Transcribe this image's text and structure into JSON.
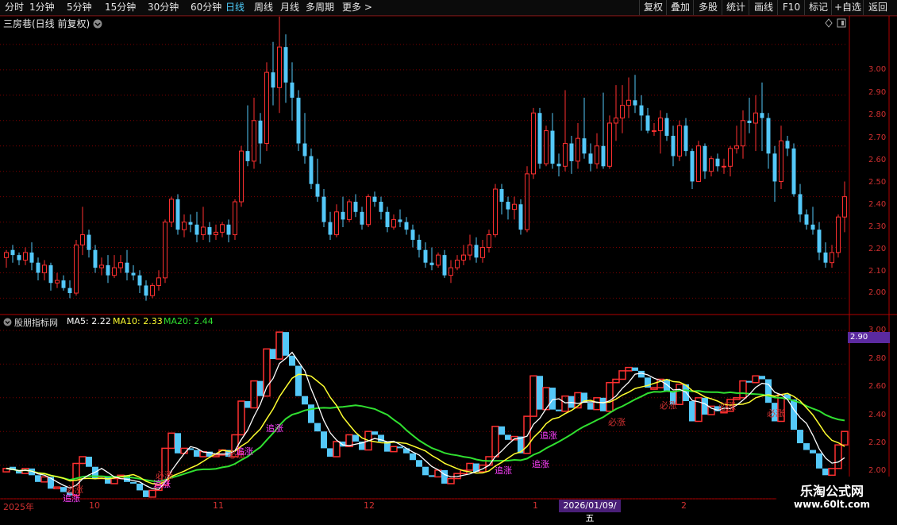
{
  "toolbar": {
    "timeframes": [
      "分时",
      "1分钟",
      "5分钟",
      "15分钟",
      "30分钟",
      "60分钟",
      "日线",
      "周线",
      "月线",
      "多周期",
      "更多"
    ],
    "active_timeframe": "日线",
    "more_arrow": ">",
    "buttons": [
      "复权",
      "叠加",
      "多股",
      "统计",
      "画线",
      "F10",
      "标记",
      "+自选",
      "返回"
    ]
  },
  "main_chart": {
    "title": "三房巷(日线 前复权)",
    "price_labels": [
      "3.00",
      "2.90",
      "2.80",
      "2.70",
      "2.60",
      "2.50",
      "2.40",
      "2.30",
      "2.20",
      "2.10",
      "2.00"
    ]
  },
  "sub_chart": {
    "name": "股朋指标网",
    "ma5": "MA5: 2.22",
    "ma10": "MA10: 2.33",
    "ma20": "MA20: 2.44",
    "price_labels": [
      "3.00",
      "2.80",
      "2.60",
      "2.40",
      "2.20",
      "2.00"
    ],
    "highlight_price": "2.90",
    "annotations": [
      "必涨",
      "追涨"
    ]
  },
  "date_axis": {
    "labels": [
      "2025年",
      "10",
      "11",
      "12",
      "1",
      "2"
    ],
    "highlight": "2026/01/09/五"
  },
  "watermark": {
    "line1": "乐淘公式网",
    "line2": "www.60lt.com"
  },
  "colors": {
    "up": "#ff3030",
    "down": "#54c8f8",
    "ma5": "#ffffff",
    "ma10": "#ffff30",
    "ma20": "#30e030",
    "grid": "#7a0000",
    "active": "#4fd0ff"
  },
  "chart_data": [
    {
      "type": "candlestick",
      "title": "三房巷(日线 前复权)",
      "ylim": [
        1.97,
        3.05
      ],
      "ohlc": [
        [
          2.16,
          2.18,
          2.12,
          2.19
        ],
        [
          2.19,
          2.17,
          2.14,
          2.21
        ],
        [
          2.17,
          2.15,
          2.13,
          2.18
        ],
        [
          2.15,
          2.18,
          2.13,
          2.2
        ],
        [
          2.18,
          2.14,
          2.11,
          2.22
        ],
        [
          2.14,
          2.1,
          2.07,
          2.16
        ],
        [
          2.1,
          2.13,
          2.07,
          2.15
        ],
        [
          2.13,
          2.06,
          2.03,
          2.14
        ],
        [
          2.06,
          2.07,
          2.04,
          2.1
        ],
        [
          2.07,
          2.04,
          2.03,
          2.09
        ],
        [
          2.04,
          2.02,
          2.0,
          2.07
        ],
        [
          2.02,
          2.21,
          2.01,
          2.23
        ],
        [
          2.21,
          2.25,
          2.17,
          2.36
        ],
        [
          2.25,
          2.19,
          2.16,
          2.27
        ],
        [
          2.19,
          2.12,
          2.1,
          2.21
        ],
        [
          2.12,
          2.13,
          2.09,
          2.16
        ],
        [
          2.13,
          2.09,
          2.06,
          2.17
        ],
        [
          2.09,
          2.12,
          2.08,
          2.17
        ],
        [
          2.12,
          2.14,
          2.1,
          2.17
        ],
        [
          2.14,
          2.1,
          2.07,
          2.19
        ],
        [
          2.1,
          2.09,
          2.07,
          2.13
        ],
        [
          2.09,
          2.05,
          2.02,
          2.11
        ],
        [
          2.05,
          2.01,
          1.99,
          2.07
        ],
        [
          2.01,
          2.05,
          2.0,
          2.06
        ],
        [
          2.05,
          2.08,
          2.03,
          2.11
        ],
        [
          2.08,
          2.3,
          2.06,
          2.31
        ],
        [
          2.3,
          2.39,
          2.28,
          2.4
        ],
        [
          2.39,
          2.27,
          2.25,
          2.41
        ],
        [
          2.27,
          2.3,
          2.24,
          2.33
        ],
        [
          2.3,
          2.29,
          2.26,
          2.33
        ],
        [
          2.29,
          2.25,
          2.22,
          2.34
        ],
        [
          2.25,
          2.28,
          2.23,
          2.36
        ],
        [
          2.28,
          2.25,
          2.22,
          2.3
        ],
        [
          2.25,
          2.26,
          2.23,
          2.29
        ],
        [
          2.26,
          2.29,
          2.24,
          2.3
        ],
        [
          2.29,
          2.25,
          2.22,
          2.31
        ],
        [
          2.25,
          2.38,
          2.23,
          2.39
        ],
        [
          2.38,
          2.58,
          2.36,
          2.6
        ],
        [
          2.58,
          2.54,
          2.52,
          2.76
        ],
        [
          2.54,
          2.7,
          2.51,
          2.79
        ],
        [
          2.7,
          2.61,
          2.53,
          2.73
        ],
        [
          2.61,
          2.89,
          2.58,
          2.93
        ],
        [
          2.89,
          2.83,
          2.76,
          3.01
        ],
        [
          2.83,
          2.99,
          2.73,
          3.11
        ],
        [
          2.99,
          2.85,
          2.77,
          3.04
        ],
        [
          2.85,
          2.79,
          2.7,
          2.93
        ],
        [
          2.79,
          2.61,
          2.58,
          2.82
        ],
        [
          2.61,
          2.56,
          2.53,
          2.73
        ],
        [
          2.56,
          2.45,
          2.43,
          2.59
        ],
        [
          2.45,
          2.4,
          2.38,
          2.55
        ],
        [
          2.4,
          2.3,
          2.28,
          2.43
        ],
        [
          2.3,
          2.25,
          2.23,
          2.34
        ],
        [
          2.25,
          2.34,
          2.24,
          2.37
        ],
        [
          2.34,
          2.31,
          2.28,
          2.4
        ],
        [
          2.31,
          2.38,
          2.3,
          2.39
        ],
        [
          2.38,
          2.34,
          2.32,
          2.41
        ],
        [
          2.34,
          2.29,
          2.27,
          2.36
        ],
        [
          2.29,
          2.4,
          2.28,
          2.41
        ],
        [
          2.4,
          2.38,
          2.36,
          2.42
        ],
        [
          2.38,
          2.34,
          2.31,
          2.4
        ],
        [
          2.34,
          2.28,
          2.26,
          2.36
        ],
        [
          2.28,
          2.31,
          2.27,
          2.33
        ],
        [
          2.31,
          2.3,
          2.28,
          2.35
        ],
        [
          2.3,
          2.27,
          2.25,
          2.32
        ],
        [
          2.27,
          2.23,
          2.2,
          2.29
        ],
        [
          2.23,
          2.19,
          2.16,
          2.25
        ],
        [
          2.19,
          2.14,
          2.12,
          2.22
        ],
        [
          2.14,
          2.13,
          2.11,
          2.2
        ],
        [
          2.13,
          2.17,
          2.12,
          2.18
        ],
        [
          2.17,
          2.09,
          2.08,
          2.19
        ],
        [
          2.09,
          2.12,
          2.06,
          2.15
        ],
        [
          2.12,
          2.15,
          2.11,
          2.17
        ],
        [
          2.15,
          2.17,
          2.13,
          2.21
        ],
        [
          2.17,
          2.21,
          2.15,
          2.25
        ],
        [
          2.21,
          2.16,
          2.14,
          2.24
        ],
        [
          2.16,
          2.2,
          2.14,
          2.23
        ],
        [
          2.2,
          2.25,
          2.18,
          2.27
        ],
        [
          2.25,
          2.43,
          2.24,
          2.45
        ],
        [
          2.43,
          2.38,
          2.33,
          2.45
        ],
        [
          2.38,
          2.35,
          2.31,
          2.4
        ],
        [
          2.35,
          2.37,
          2.31,
          2.4
        ],
        [
          2.37,
          2.27,
          2.25,
          2.39
        ],
        [
          2.27,
          2.49,
          2.26,
          2.52
        ],
        [
          2.49,
          2.73,
          2.47,
          2.75
        ],
        [
          2.73,
          2.53,
          2.51,
          2.75
        ],
        [
          2.53,
          2.66,
          2.52,
          2.68
        ],
        [
          2.66,
          2.53,
          2.51,
          2.73
        ],
        [
          2.53,
          2.52,
          2.48,
          2.57
        ],
        [
          2.52,
          2.61,
          2.5,
          2.82
        ],
        [
          2.61,
          2.54,
          2.49,
          2.64
        ],
        [
          2.54,
          2.63,
          2.51,
          2.69
        ],
        [
          2.63,
          2.57,
          2.55,
          2.79
        ],
        [
          2.57,
          2.53,
          2.5,
          2.61
        ],
        [
          2.53,
          2.6,
          2.51,
          2.65
        ],
        [
          2.6,
          2.52,
          2.51,
          2.81
        ],
        [
          2.52,
          2.69,
          2.51,
          2.72
        ],
        [
          2.69,
          2.71,
          2.62,
          2.84
        ],
        [
          2.71,
          2.76,
          2.65,
          2.84
        ],
        [
          2.76,
          2.78,
          2.71,
          2.87
        ],
        [
          2.78,
          2.76,
          2.73,
          2.88
        ],
        [
          2.76,
          2.72,
          2.66,
          2.8
        ],
        [
          2.72,
          2.66,
          2.65,
          2.75
        ],
        [
          2.66,
          2.66,
          2.64,
          2.69
        ],
        [
          2.66,
          2.71,
          2.57,
          2.74
        ],
        [
          2.71,
          2.64,
          2.62,
          2.73
        ],
        [
          2.64,
          2.56,
          2.52,
          2.68
        ],
        [
          2.56,
          2.68,
          2.54,
          2.7
        ],
        [
          2.68,
          2.58,
          2.56,
          2.71
        ],
        [
          2.58,
          2.46,
          2.43,
          2.59
        ],
        [
          2.46,
          2.6,
          2.46,
          2.62
        ],
        [
          2.6,
          2.5,
          2.47,
          2.61
        ],
        [
          2.5,
          2.55,
          2.48,
          2.56
        ],
        [
          2.55,
          2.52,
          2.5,
          2.57
        ],
        [
          2.52,
          2.52,
          2.49,
          2.55
        ],
        [
          2.52,
          2.59,
          2.48,
          2.6
        ],
        [
          2.59,
          2.6,
          2.57,
          2.68
        ],
        [
          2.6,
          2.7,
          2.55,
          2.74
        ],
        [
          2.7,
          2.69,
          2.65,
          2.79
        ],
        [
          2.69,
          2.73,
          2.58,
          2.8
        ],
        [
          2.73,
          2.71,
          2.58,
          2.85
        ],
        [
          2.71,
          2.57,
          2.51,
          2.73
        ],
        [
          2.57,
          2.46,
          2.38,
          2.6
        ],
        [
          2.46,
          2.62,
          2.43,
          2.68
        ],
        [
          2.62,
          2.59,
          2.56,
          2.64
        ],
        [
          2.59,
          2.41,
          2.4,
          2.61
        ],
        [
          2.41,
          2.33,
          2.3,
          2.45
        ],
        [
          2.33,
          2.29,
          2.27,
          2.35
        ],
        [
          2.29,
          2.27,
          2.25,
          2.36
        ],
        [
          2.27,
          2.18,
          2.15,
          2.3
        ],
        [
          2.18,
          2.14,
          2.12,
          2.22
        ],
        [
          2.14,
          2.18,
          2.12,
          2.21
        ],
        [
          2.18,
          2.32,
          2.16,
          2.33
        ],
        [
          2.32,
          2.4,
          2.26,
          2.46
        ]
      ]
    },
    {
      "type": "line",
      "title": "股朋指标网",
      "ylim": [
        2.0,
        3.0
      ],
      "series": [
        {
          "name": "MA5",
          "color": "#ffffff"
        },
        {
          "name": "MA10",
          "color": "#ffff30"
        },
        {
          "name": "MA20",
          "color": "#30e030"
        }
      ]
    }
  ]
}
